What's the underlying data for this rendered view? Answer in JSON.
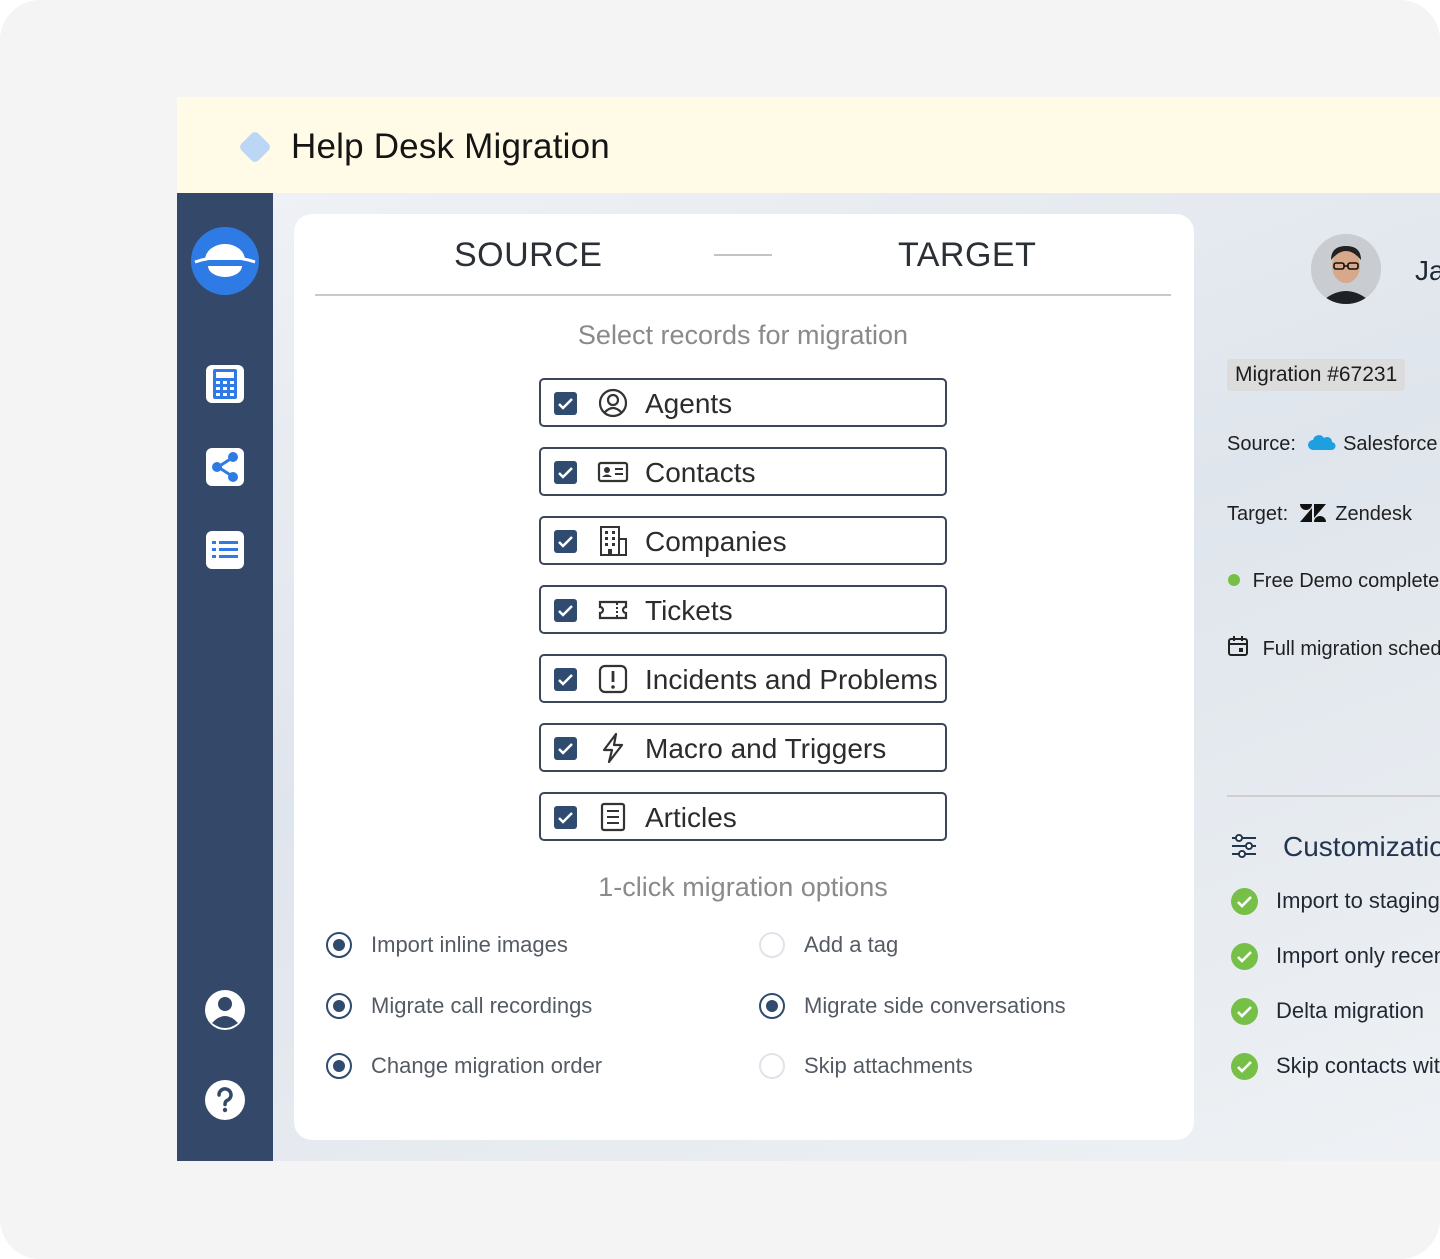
{
  "app": {
    "title": "Help Desk Migration"
  },
  "sidebar": {
    "items": [
      {
        "icon": "calculator-icon"
      },
      {
        "icon": "share-icon"
      },
      {
        "icon": "list-icon"
      },
      {
        "icon": "user-icon"
      },
      {
        "icon": "help-icon"
      }
    ]
  },
  "header": {
    "source": "SOURCE",
    "target": "TARGET"
  },
  "records": {
    "title": "Select records for migration",
    "items": [
      {
        "label": "Agents",
        "checked": true,
        "icon": "agent-icon"
      },
      {
        "label": "Contacts",
        "checked": true,
        "icon": "contact-card-icon"
      },
      {
        "label": "Companies",
        "checked": true,
        "icon": "building-icon"
      },
      {
        "label": "Tickets",
        "checked": true,
        "icon": "ticket-icon"
      },
      {
        "label": "Incidents and Problems",
        "checked": true,
        "icon": "alert-icon"
      },
      {
        "label": "Macro and Triggers",
        "checked": true,
        "icon": "lightning-icon"
      },
      {
        "label": "Articles",
        "checked": true,
        "icon": "article-icon"
      }
    ]
  },
  "options": {
    "title": "1-click migration options",
    "items": [
      {
        "label": "Import inline images",
        "selected": true
      },
      {
        "label": "Add a tag",
        "selected": false
      },
      {
        "label": "Migrate call recordings",
        "selected": true
      },
      {
        "label": "Migrate side conversations",
        "selected": true
      },
      {
        "label": "Change migration order",
        "selected": true
      },
      {
        "label": "Skip attachments",
        "selected": false
      }
    ]
  },
  "details": {
    "user_name": "Jam",
    "migration_id": "Migration #67231",
    "source_label": "Source:",
    "source_value": "Salesforce Ser",
    "target_label": "Target:",
    "target_value": "Zendesk",
    "demo_status": "Free Demo complete",
    "schedule_status": "Full migration schedule",
    "status_color": "#76c047"
  },
  "customization": {
    "title": "Customization",
    "items": [
      {
        "label": "Import to staging f"
      },
      {
        "label": "Import only recent"
      },
      {
        "label": "Delta migration"
      },
      {
        "label": "Skip contacts with"
      }
    ]
  },
  "colors": {
    "sidebar": "#34496a",
    "accent": "#2f4b70",
    "logo": "#2f7be5",
    "title_bar": "#fffbe6",
    "success": "#76c047"
  }
}
